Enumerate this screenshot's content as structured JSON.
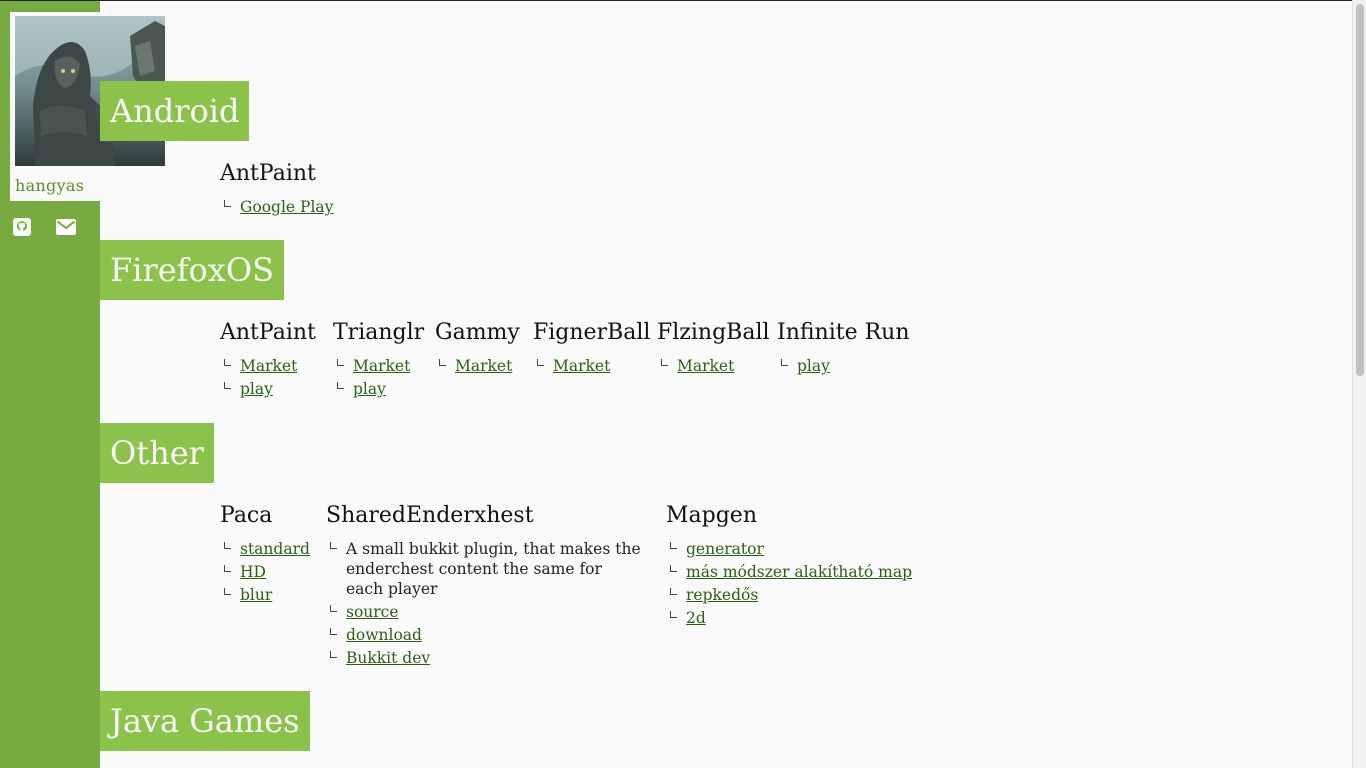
{
  "sidebar": {
    "username": "hangyas",
    "avatar_alt": "avatar"
  },
  "colors": {
    "sidebar": "#78ab3f",
    "section_header": "#8bc34a",
    "link": "#2e5e14",
    "username": "#5b8e2a"
  },
  "icons": {
    "github": "github-icon",
    "mail": "envelope-icon"
  },
  "sections": {
    "android": {
      "title": "Android",
      "projects": [
        {
          "name": "AntPaint",
          "links": [
            "Google Play"
          ]
        }
      ]
    },
    "firefoxos": {
      "title": "FirefoxOS",
      "projects": [
        {
          "name": "AntPaint",
          "links": [
            "Market",
            "play"
          ]
        },
        {
          "name": "Trianglr",
          "links": [
            "Market",
            "play"
          ]
        },
        {
          "name": "Gammy",
          "links": [
            "Market"
          ]
        },
        {
          "name": "FignerBall",
          "links": [
            "Market"
          ]
        },
        {
          "name": "FlzingBall",
          "links": [
            "Market"
          ]
        },
        {
          "name": "Infinite Run",
          "links": [
            "play"
          ]
        }
      ]
    },
    "other": {
      "title": "Other",
      "projects": [
        {
          "name": "Paca",
          "links": [
            "standard",
            "HD",
            "blur"
          ]
        },
        {
          "name": "SharedEnderxhest",
          "description": "A small bukkit plugin, that makes the enderchest content the same for each player",
          "links": [
            "source",
            "download",
            "Bukkit dev"
          ]
        },
        {
          "name": "Mapgen",
          "links": [
            "generator",
            "más módszer alakítható map",
            "repkedős",
            "2d"
          ]
        }
      ]
    },
    "java_games": {
      "title": "Java Games"
    }
  }
}
